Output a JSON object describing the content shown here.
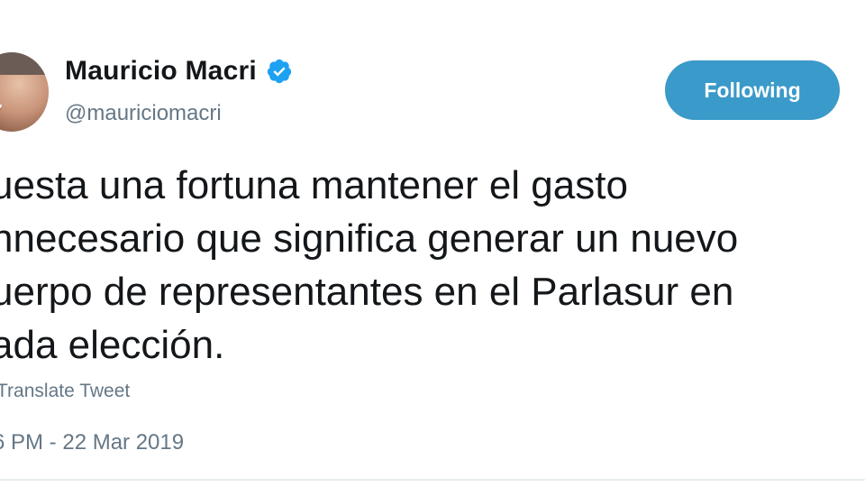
{
  "user": {
    "display_name": "Mauricio Macri",
    "handle": "@mauriciomacri",
    "verified_icon": "verified-badge-icon"
  },
  "follow_button": {
    "label": "Following"
  },
  "tweet": {
    "lines": [
      "uesta una fortuna mantener el gasto",
      "nnecesario que significa generar un nuevo",
      "uerpo de representantes en el Parlasur en",
      "ada elección."
    ],
    "translate_label": "Translate Tweet",
    "timestamp": "6 PM - 22 Mar 2019"
  },
  "colors": {
    "accent": "#3a9ac9",
    "verified": "#1da1f2",
    "secondary_text": "#657786"
  }
}
